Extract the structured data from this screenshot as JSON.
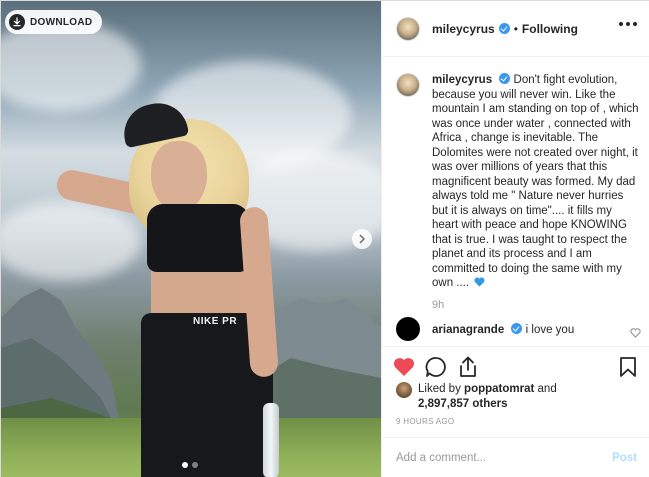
{
  "photo": {
    "download_label": "DOWNLOAD",
    "download_icon": "download-icon",
    "next_icon": "chevron-right-icon",
    "pants_label": "NIKE PR",
    "carousel": {
      "count": 2,
      "active": 1
    }
  },
  "header": {
    "username": "mileycyrus",
    "separator": "•",
    "follow_state": "Following",
    "more_icon": "more-options-icon"
  },
  "caption": {
    "username": "mileycyrus",
    "text": "Don't fight evolution, because you will never win. Like the mountain I am standing on top of , which was once under water , connected with Africa , change is inevitable. The Dolomites were not created over night, it was over millions of years that this magnificent beauty was formed. My dad always told me \" Nature never hurries but it is always on time\".... it fills my heart with peace and hope KNOWING that is true. I was taught to respect the planet and its process and I am committed to doing the same with my own ....",
    "emoji": "blue-heart",
    "time": "9h"
  },
  "comment": {
    "username": "arianagrande",
    "text": "i love you"
  },
  "actions": {
    "like_icon": "heart-filled-icon",
    "comment_icon": "comment-icon",
    "share_icon": "share-icon",
    "save_icon": "bookmark-icon",
    "like_color": "#ed4956"
  },
  "likes": {
    "prefix": "Liked by",
    "user": "poppatomrat",
    "conjunction": "and",
    "count": "2,897,857 others"
  },
  "timestamp": "9 HOURS AGO",
  "add_comment": {
    "placeholder": "Add a comment...",
    "post_label": "Post"
  },
  "colors": {
    "verified": "#3897f0",
    "muted_text": "#999999",
    "post_disabled": "#b2dffc",
    "border": "#efefef"
  }
}
